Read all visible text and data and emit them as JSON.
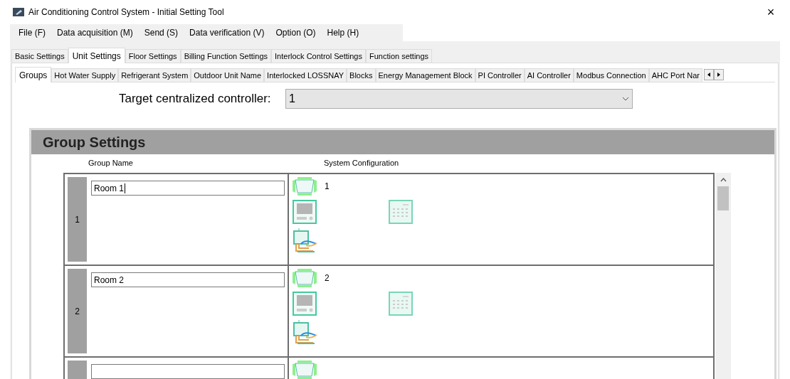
{
  "window": {
    "title": "Air Conditioning Control System - Initial Setting Tool",
    "close": "×"
  },
  "menu": [
    "File (F)",
    "Data acquisition (M)",
    "Send (S)",
    "Data verification (V)",
    "Option (O)",
    "Help (H)"
  ],
  "tabs": [
    {
      "label": "Basic Settings",
      "selected": false
    },
    {
      "label": "Unit Settings",
      "selected": true
    },
    {
      "label": "Floor Settings",
      "selected": false
    },
    {
      "label": "Billing Function Settings",
      "selected": false
    },
    {
      "label": "Interlock Control Settings",
      "selected": false
    },
    {
      "label": "Function settings",
      "selected": false
    }
  ],
  "subtabs": [
    {
      "label": "Groups",
      "selected": true
    },
    {
      "label": "Hot Water Supply",
      "selected": false
    },
    {
      "label": "Refrigerant System",
      "selected": false
    },
    {
      "label": "Outdoor Unit Name",
      "selected": false
    },
    {
      "label": "Interlocked LOSSNAY",
      "selected": false
    },
    {
      "label": "Blocks",
      "selected": false
    },
    {
      "label": "Energy Management Block",
      "selected": false
    },
    {
      "label": "PI Controller",
      "selected": false
    },
    {
      "label": "AI Controller",
      "selected": false
    },
    {
      "label": "Modbus Connection",
      "selected": false
    },
    {
      "label": "AHC Port Nar",
      "selected": false
    }
  ],
  "controller": {
    "label": "Target centralized controller:",
    "value": "1"
  },
  "group_settings": {
    "title": "Group Settings",
    "columns": [
      "Group Name",
      "System Configuration"
    ],
    "rows": [
      {
        "number": "1",
        "name": "Room 1",
        "unit": "1",
        "caret": true
      },
      {
        "number": "2",
        "name": "Room 2",
        "unit": "2",
        "caret": false
      },
      {
        "caret": false
      }
    ]
  }
}
